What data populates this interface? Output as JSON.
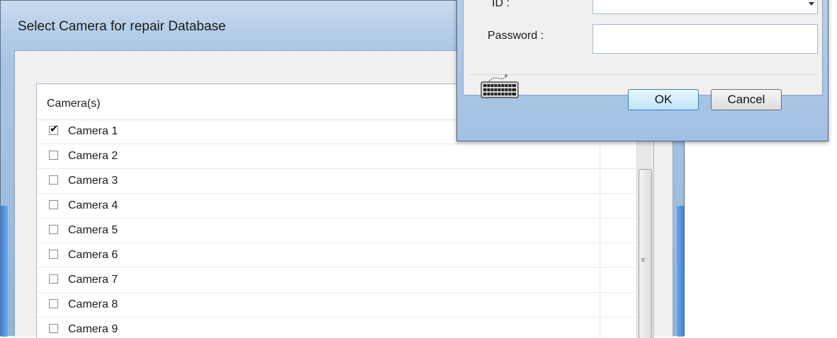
{
  "camera_window": {
    "title": "Select Camera for repair Database",
    "list_header": "Camera(s)",
    "cameras": [
      {
        "label": "Camera 1",
        "checked": true
      },
      {
        "label": "Camera 2",
        "checked": false
      },
      {
        "label": "Camera 3",
        "checked": false
      },
      {
        "label": "Camera 4",
        "checked": false
      },
      {
        "label": "Camera 5",
        "checked": false
      },
      {
        "label": "Camera 6",
        "checked": false
      },
      {
        "label": "Camera 7",
        "checked": false
      },
      {
        "label": "Camera 8",
        "checked": false
      },
      {
        "label": "Camera 9",
        "checked": false
      }
    ]
  },
  "login_dialog": {
    "id_label": "ID :",
    "id_value": "",
    "password_label": "Password :",
    "password_value": "",
    "ok_label": "OK",
    "cancel_label": "Cancel",
    "keyboard_icon": "virtual-keyboard-icon"
  },
  "colors": {
    "window_frame": "#a9c5e4",
    "accent_edge": "#3d82d8",
    "default_button_border": "#3c7fb1"
  }
}
